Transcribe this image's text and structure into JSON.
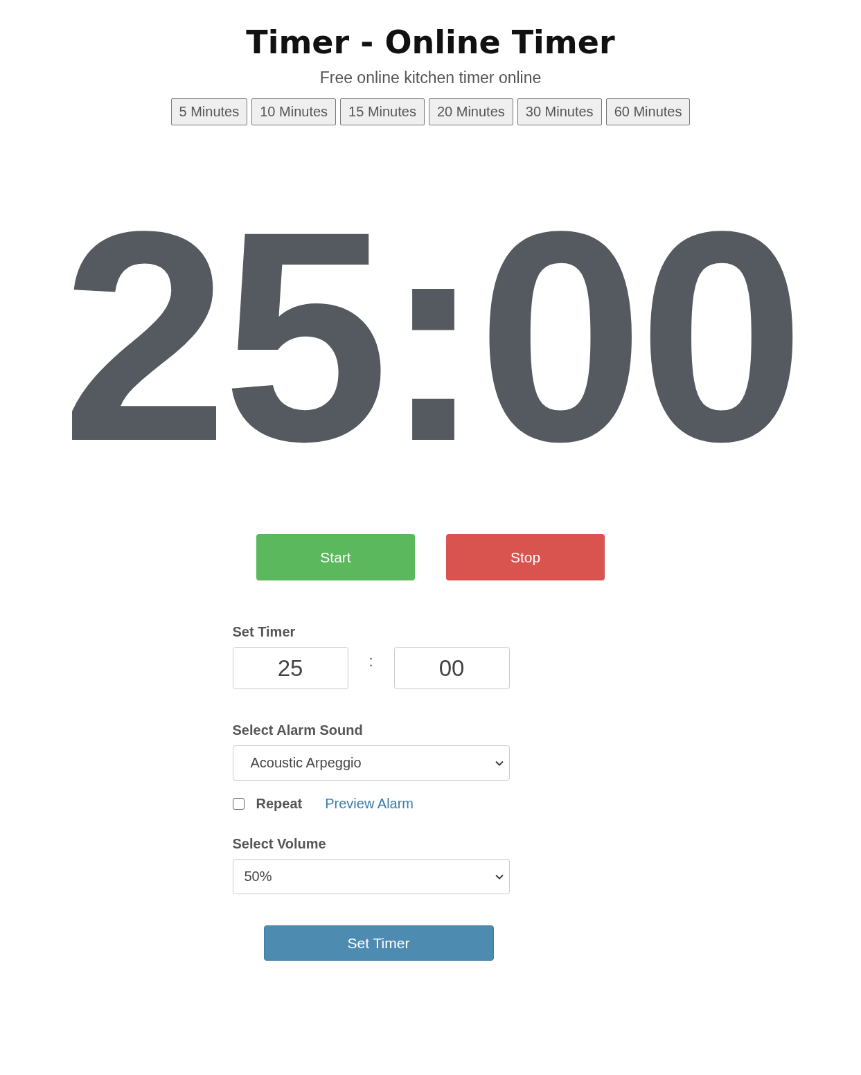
{
  "header": {
    "title": "Timer - Online Timer",
    "subtitle": "Free online kitchen timer online"
  },
  "presets": [
    "5 Minutes",
    "10 Minutes",
    "15 Minutes",
    "20 Minutes",
    "30 Minutes",
    "60 Minutes"
  ],
  "display": {
    "time": "25:00"
  },
  "controls": [
    {
      "label": "Start",
      "kind": "start"
    },
    {
      "label": "Stop",
      "kind": "stop"
    }
  ],
  "settings": {
    "set_timer_label": "Set Timer",
    "minutes": "25",
    "separator": ":",
    "seconds": "00",
    "alarm_label": "Select Alarm Sound",
    "alarm_sound": "Acoustic Arpeggio",
    "repeat": {
      "label": "Repeat",
      "checked": false
    },
    "preview_link": "Preview Alarm",
    "volume_label": "Select Volume",
    "volume": "50%",
    "submit": "Set Timer"
  }
}
